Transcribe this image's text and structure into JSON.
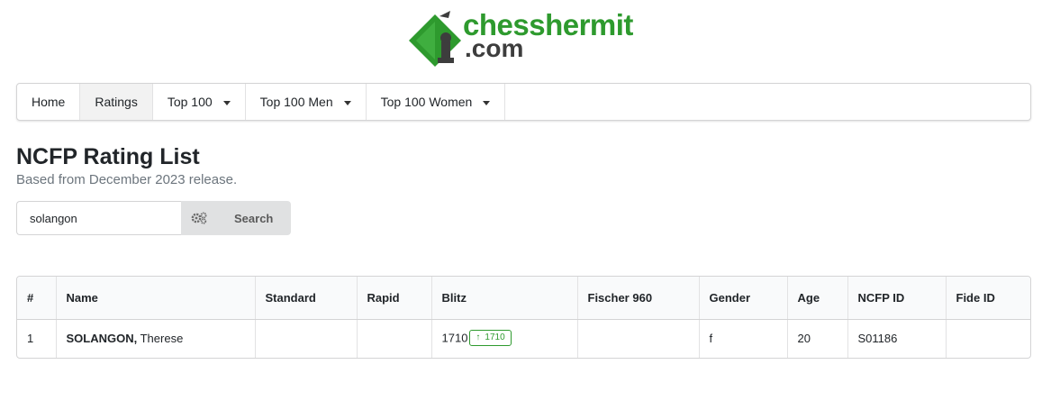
{
  "logo": {
    "text_line1": "chesshermit",
    "text_line2": ".com",
    "colors": {
      "green": "#2e9a2e",
      "dark": "#3d3d3d"
    }
  },
  "nav": {
    "items": [
      {
        "label": "Home",
        "active": false,
        "dropdown": false
      },
      {
        "label": "Ratings",
        "active": true,
        "dropdown": false
      },
      {
        "label": "Top 100",
        "active": false,
        "dropdown": true
      },
      {
        "label": "Top 100 Men",
        "active": false,
        "dropdown": true
      },
      {
        "label": "Top 100 Women",
        "active": false,
        "dropdown": true
      }
    ]
  },
  "page": {
    "title": "NCFP Rating List",
    "subtitle": "Based from December 2023 release."
  },
  "search": {
    "value": "solangon",
    "button_label": "Search",
    "button_icon": "cogs-icon"
  },
  "table": {
    "headers": [
      "#",
      "Name",
      "Standard",
      "Rapid",
      "Blitz",
      "Fischer 960",
      "Gender",
      "Age",
      "NCFP ID",
      "Fide ID"
    ],
    "rows": [
      {
        "num": "1",
        "name_last": "SOLANGON,",
        "name_first": " Therese",
        "standard": "",
        "rapid": "",
        "blitz": "1710",
        "blitz_badge": "1710",
        "fischer960": "",
        "gender": "f",
        "age": "20",
        "ncfp_id": "S01186",
        "fide_id": ""
      }
    ]
  }
}
